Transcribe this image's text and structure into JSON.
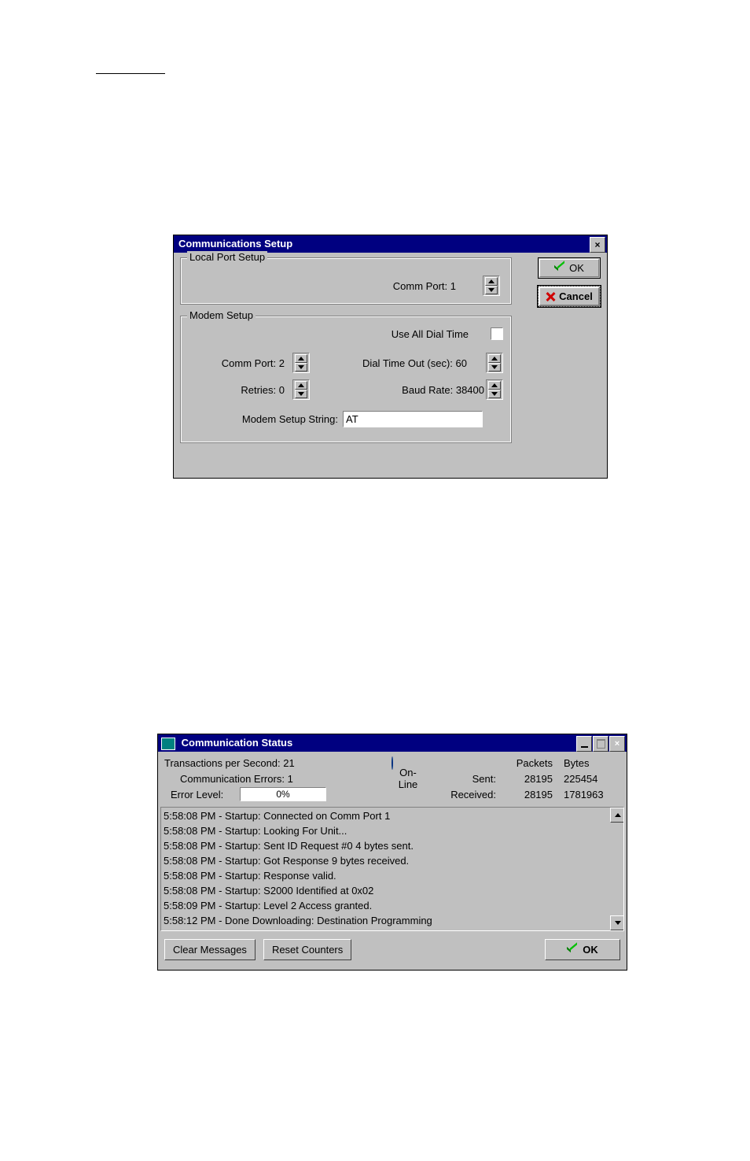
{
  "dlg1": {
    "title": "Communications Setup",
    "localPort": {
      "legend": "Local Port Setup",
      "commPortLabel": "Comm Port:",
      "commPort": "1"
    },
    "modem": {
      "legend": "Modem Setup",
      "useAllDialTimeLabel": "Use All Dial Time",
      "useAllDialTime": false,
      "commPortLabel": "Comm Port:",
      "commPort": "2",
      "retriesLabel": "Retries:",
      "retries": "0",
      "dialTimeoutLabel": "Dial Time Out (sec):",
      "dialTimeout": "60",
      "baudRateLabel": "Baud Rate:",
      "baudRate": "38400",
      "setupStringLabel": "Modem Setup String:",
      "setupString": "AT"
    },
    "buttons": {
      "ok": "OK",
      "cancel": "Cancel"
    }
  },
  "dlg2": {
    "title": "Communication Status",
    "stats": {
      "tpsLabel": "Transactions per Second:",
      "tps": "21",
      "commErrorsLabel": "Communication Errors:",
      "commErrors": "1",
      "errorLevelLabel": "Error Level:",
      "errorLevel": "0%",
      "onlineLabel": "On-Line",
      "packetsHeader": "Packets",
      "bytesHeader": "Bytes",
      "sentLabel": "Sent:",
      "sentPackets": "28195",
      "sentBytes": "225454",
      "receivedLabel": "Received:",
      "receivedPackets": "28195",
      "receivedBytes": "1781963"
    },
    "log": [
      "5:58:08 PM - Startup: Connected on Comm Port 1",
      "5:58:08 PM - Startup: Looking For Unit...",
      "5:58:08 PM - Startup: Sent ID Request #0 4 bytes sent.",
      "5:58:08 PM - Startup: Got Response 9 bytes received.",
      "5:58:08 PM - Startup: Response valid.",
      "5:58:08 PM - Startup: S2000 Identified at 0x02",
      "5:58:09 PM - Startup: Level 2 Access granted.",
      "5:58:12 PM - Done Downloading: Destination Programming"
    ],
    "buttons": {
      "clear": "Clear Messages",
      "reset": "Reset Counters",
      "ok": "OK"
    }
  }
}
